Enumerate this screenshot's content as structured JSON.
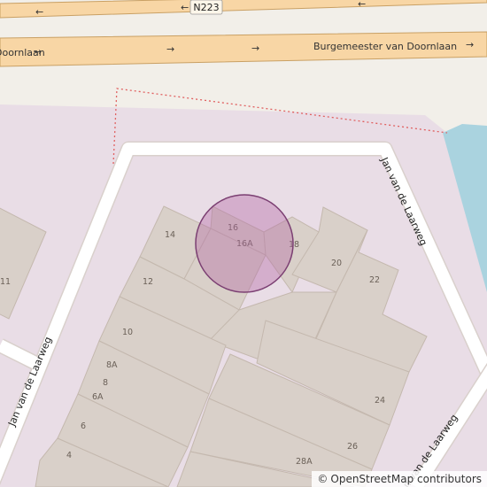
{
  "map": {
    "roads": {
      "top_road_name": "N223",
      "main_road_name_left": "Doornlaan",
      "main_road_name_right": "Burgemeester van Doornlaan",
      "side_street_right": "Jan van de Laarweg",
      "side_street_left": "Jan van de Laarweg",
      "side_street_bottom_right": "Jan van de Laarweg"
    },
    "house_numbers": [
      "14",
      "16",
      "16A",
      "18",
      "20",
      "22",
      "12",
      "10",
      "8A",
      "8",
      "6A",
      "6",
      "4",
      "24",
      "26",
      "28A",
      "11"
    ],
    "marker": {
      "type": "location-circle"
    },
    "colors": {
      "background": "#f2efe9",
      "residential": "#e9dde6",
      "building": "#d9d0c9",
      "building_stroke": "#c4b8ae",
      "road_main": "#f8d6a5",
      "road_casing": "#c9a064",
      "street": "#ffffff",
      "water": "#aad3df",
      "marker_fill": "#b56aa6",
      "marker_stroke": "#7b3f72"
    }
  },
  "attribution": {
    "copyright_symbol": "©",
    "text": "OpenStreetMap contributors"
  }
}
